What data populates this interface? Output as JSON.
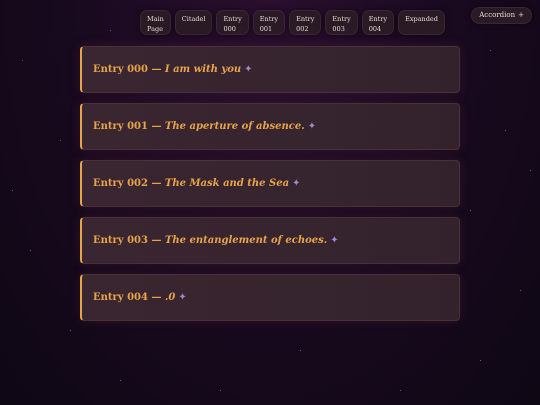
{
  "nav": {
    "items": [
      {
        "lines": [
          "Main",
          "Page"
        ]
      },
      {
        "lines": [
          "Citadel",
          ""
        ]
      },
      {
        "lines": [
          "Entry",
          "000"
        ]
      },
      {
        "lines": [
          "Entry",
          "001"
        ]
      },
      {
        "lines": [
          "Entry",
          "002"
        ]
      },
      {
        "lines": [
          "Entry",
          "003"
        ]
      },
      {
        "lines": [
          "Entry",
          "004"
        ]
      },
      {
        "lines": [
          "Expanded",
          ""
        ]
      }
    ]
  },
  "accordion": {
    "label": "Accordion",
    "icon": "+"
  },
  "entries": [
    {
      "label": "Entry 000",
      "dash": "—",
      "subtitle": "I am with you"
    },
    {
      "label": "Entry 001",
      "dash": "—",
      "subtitle": "The aperture of absence."
    },
    {
      "label": "Entry 002",
      "dash": "—",
      "subtitle": "The Mask and the Sea"
    },
    {
      "label": "Entry 003",
      "dash": "—",
      "subtitle": "The entanglement of echoes."
    },
    {
      "label": "Entry 004",
      "dash": "—",
      "subtitle": ".0"
    }
  ],
  "icons": {
    "sparkle": "sparkle-icon"
  },
  "colors": {
    "accent": "#e8a44a",
    "sparkle": "#9c8ac8"
  }
}
